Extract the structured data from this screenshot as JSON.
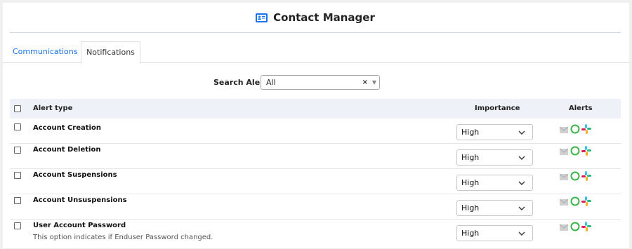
{
  "app": {
    "title": "Contact Manager"
  },
  "tabs": [
    {
      "label": "Communications",
      "active": false
    },
    {
      "label": "Notifications",
      "active": true
    }
  ],
  "search": {
    "label": "Search Alert :",
    "value": "All",
    "clear": "×",
    "caret": "▼"
  },
  "table": {
    "headers": {
      "alert_type": "Alert type",
      "importance": "Importance",
      "alerts": "Alerts"
    },
    "rows": [
      {
        "title": "Account Creation",
        "description": "",
        "importance": "High"
      },
      {
        "title": "Account Deletion",
        "description": "",
        "importance": "High"
      },
      {
        "title": "Account Suspensions",
        "description": "",
        "importance": "High"
      },
      {
        "title": "Account Unsuspensions",
        "description": "",
        "importance": "High"
      },
      {
        "title": "User Account Password",
        "description": "This option indicates if Enduser Password changed.",
        "importance": "High"
      }
    ],
    "alert_icons": [
      "email-icon",
      "sms-icon",
      "slack-icon"
    ]
  },
  "colors": {
    "accent": "#1a73e8",
    "header_bg": "#eef1f7",
    "sms_green": "#3bb54a"
  }
}
